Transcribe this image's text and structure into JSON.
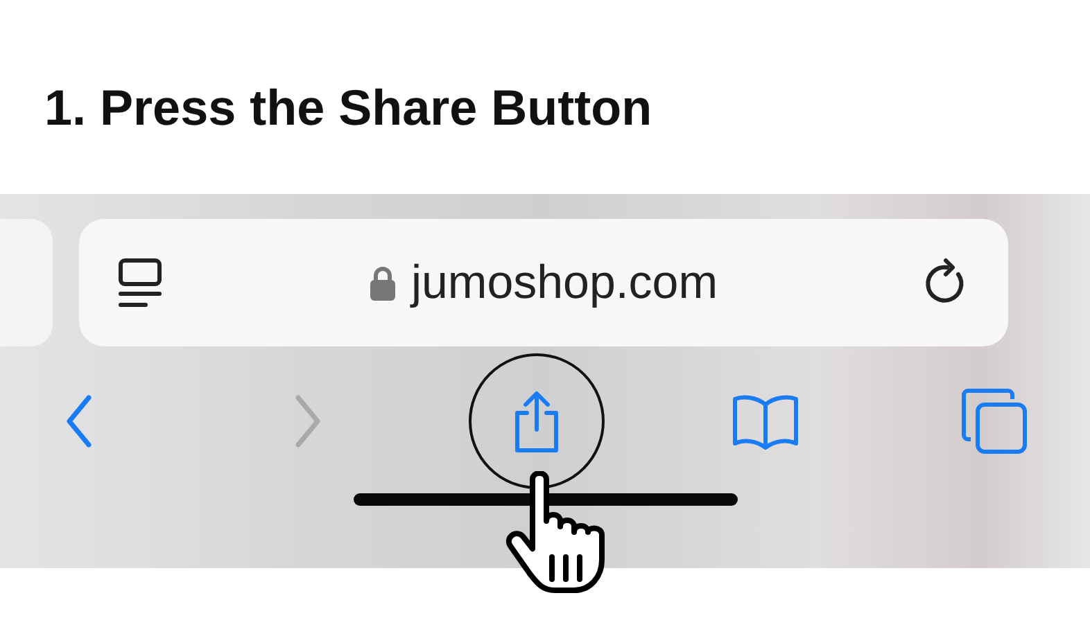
{
  "heading": "1. Press the Share Button",
  "address_bar": {
    "url": "jumoshop.com",
    "secure": true
  },
  "toolbar": [
    {
      "kind": "back",
      "disabled": false,
      "highlighted": false
    },
    {
      "kind": "forward",
      "disabled": true,
      "highlighted": false
    },
    {
      "kind": "share",
      "disabled": false,
      "highlighted": true
    },
    {
      "kind": "bookmarks",
      "disabled": false,
      "highlighted": false
    },
    {
      "kind": "tabs",
      "disabled": false,
      "highlighted": false
    }
  ]
}
